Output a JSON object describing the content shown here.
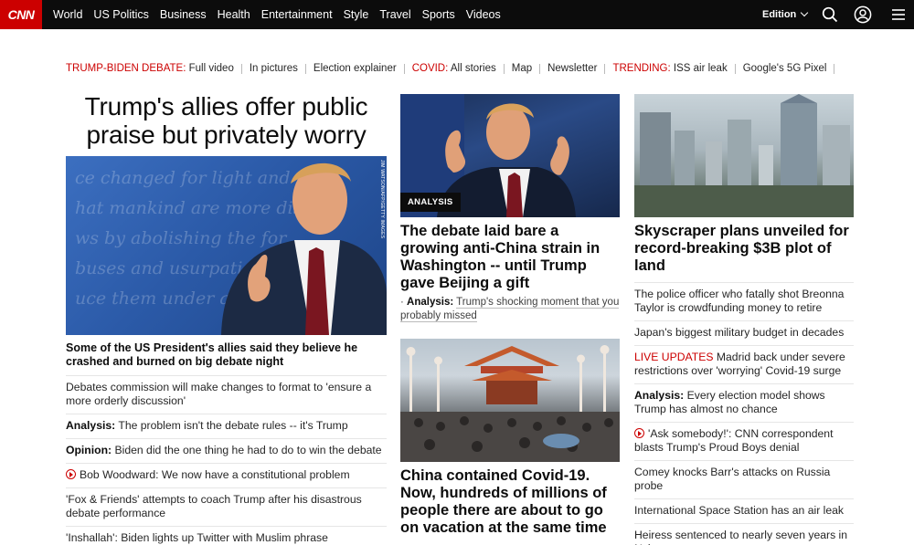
{
  "nav": {
    "logo": "CNN",
    "links": [
      "World",
      "US Politics",
      "Business",
      "Health",
      "Entertainment",
      "Style",
      "Travel",
      "Sports",
      "Videos"
    ],
    "edition": "Edition"
  },
  "ticker": [
    {
      "label": "TRUMP-BIDEN DEBATE:",
      "text": "Full video"
    },
    {
      "label": "",
      "text": "In pictures"
    },
    {
      "label": "",
      "text": "Election explainer"
    },
    {
      "label": "COVID:",
      "text": "All stories"
    },
    {
      "label": "",
      "text": "Map"
    },
    {
      "label": "",
      "text": "Newsletter"
    },
    {
      "label": "TRENDING:",
      "text": "ISS air leak"
    },
    {
      "label": "",
      "text": "Google's 5G Pixel"
    }
  ],
  "col1": {
    "headline_line1": "Trump's allies offer public",
    "headline_line2": "praise but privately worry",
    "image_credit": "JIM WATSON/AFP/GETTY IMAGES",
    "caption": "Some of the US President's allies said they believe he crashed and burned on big debate night",
    "items": [
      {
        "prefix": "",
        "text": "Debates commission will make changes to format to 'ensure a more orderly discussion'"
      },
      {
        "prefix": "Analysis:",
        "text": "The problem isn't the debate rules -- it's Trump"
      },
      {
        "prefix": "Opinion:",
        "text": "Biden did the one thing he had to do to win the debate"
      },
      {
        "prefix": "",
        "text": "Bob Woodward: We now have a constitutional problem",
        "video": true
      },
      {
        "prefix": "",
        "text": "'Fox & Friends' attempts to coach Trump after his disastrous debate performance"
      },
      {
        "prefix": "",
        "text": "'Inshallah': Biden lights up Twitter with Muslim phrase"
      }
    ]
  },
  "col2": {
    "badge": "ANALYSIS",
    "story1_title": "The debate laid bare a growing anti-China strain in Washington -- until Trump gave Beijing a gift",
    "story1_sub_prefix": "Analysis:",
    "story1_sub_text": "Trump's shocking moment that you probably missed",
    "story2_title": "China contained Covid-19. Now, hundreds of millions of people there are about to go on vacation at the same time"
  },
  "col3": {
    "title": "Skyscraper plans unveiled for record-breaking $3B plot of land",
    "items": [
      {
        "prefix": "",
        "text": "The police officer who fatally shot Breonna Taylor is crowdfunding money to retire"
      },
      {
        "prefix": "",
        "text": "Japan's biggest military budget in decades"
      },
      {
        "live": "LIVE UPDATES",
        "prefix": "",
        "text": "Madrid back under severe restrictions over 'worrying' Covid-19 surge"
      },
      {
        "prefix": "Analysis:",
        "text": "Every election model shows Trump has almost no chance"
      },
      {
        "prefix": "",
        "text": "'Ask somebody!': CNN correspondent blasts Trump's Proud Boys denial",
        "video": true
      },
      {
        "prefix": "",
        "text": "Comey knocks Barr's attacks on Russia probe"
      },
      {
        "prefix": "",
        "text": "International Space Station has an air leak"
      },
      {
        "prefix": "",
        "text": "Heiress sentenced to nearly seven years in Nxivm case"
      }
    ]
  },
  "colors": {
    "brand": "#cc0000",
    "nav_bg": "#0c0c0c"
  }
}
